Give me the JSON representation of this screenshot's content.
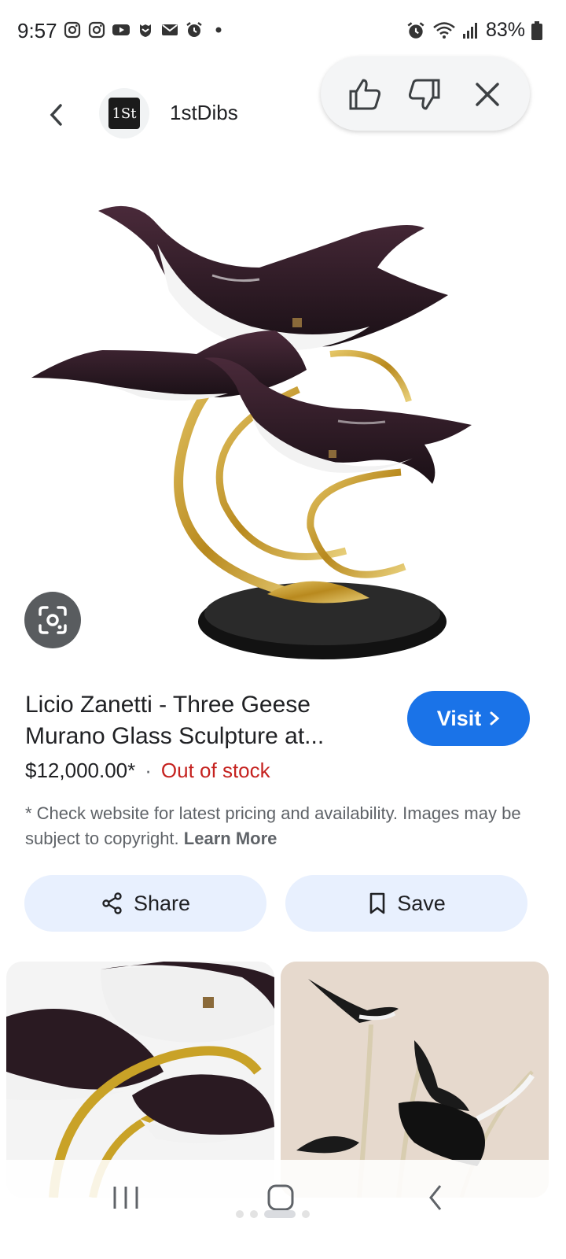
{
  "status_bar": {
    "time": "9:57",
    "battery": "83%"
  },
  "header": {
    "site_name": "1stDibs",
    "logo_text": "1St"
  },
  "result": {
    "title": "Licio Zanetti - Three Geese Murano Glass Sculpture at...",
    "visit_label": "Visit",
    "price": "$12,000.00*",
    "separator": "·",
    "stock_status": "Out of stock",
    "disclaimer": "* Check website for latest pricing and availability. Images may be subject to copyright.",
    "learn_more": "Learn More"
  },
  "actions": {
    "share_label": "Share",
    "save_label": "Save"
  },
  "colors": {
    "accent": "#1a73e8",
    "out_of_stock": "#c5221f",
    "action_bg": "#e8f0fe",
    "gold": "#c9a227"
  },
  "icons": {
    "status": [
      "instagram-icon",
      "instagram-icon",
      "youtube-icon",
      "shield-icon",
      "mail-icon",
      "alarm-icon",
      "dot-icon"
    ],
    "status_right": [
      "alarm-icon",
      "wifi-icon",
      "signal-icon",
      "battery-icon"
    ],
    "feedback": [
      "thumbs-up-icon",
      "thumbs-down-icon",
      "close-icon"
    ]
  }
}
